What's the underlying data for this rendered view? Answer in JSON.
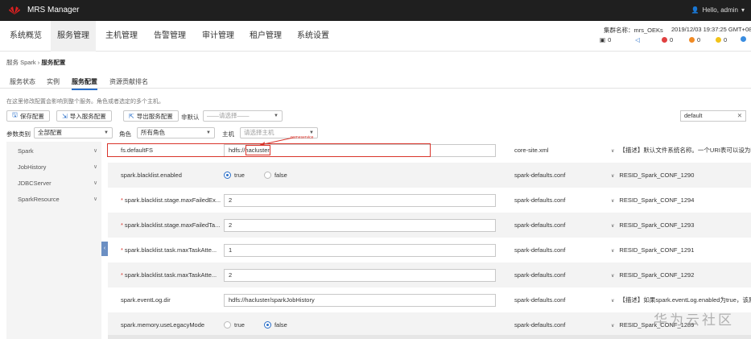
{
  "topbar": {
    "title": "MRS Manager",
    "user": "Hello, admin"
  },
  "nav": {
    "items": [
      "系统概览",
      "服务管理",
      "主机管理",
      "告警管理",
      "审计管理",
      "租户管理",
      "系统设置"
    ],
    "cluster_name": "集群名称：mrs_OEKs",
    "time": "2019/12/03 19:37:25 GMT+08",
    "counts": [
      "0",
      "0",
      "0",
      "0",
      "0"
    ]
  },
  "breadcrumb": {
    "root": "服务 Spark",
    "current": "服务配置"
  },
  "tabs": [
    "服务状态",
    "实例",
    "服务配置",
    "资源贡献排名"
  ],
  "hint": "在这里修改配置会影响到整个服务。角色或者选定的多个主机。",
  "toolbar": {
    "save": "保存配置",
    "import": "导入服务配置",
    "export": "导出服务配置",
    "non_default_label": "非默认",
    "non_default_placeholder": "——请选择——",
    "param_type_label": "参数类别",
    "param_type_value": "全部配置",
    "role_label": "角色",
    "role_value": "所有角色",
    "host_label": "主机",
    "host_placeholder": "请选择主机",
    "search_value": "default"
  },
  "sidebar": {
    "items": [
      "Spark",
      "JobHistory",
      "JDBCServer",
      "SparkResource"
    ]
  },
  "rows": [
    {
      "name": "fs.defaultFS",
      "required": false,
      "value": "hdfs://hacluster",
      "file": "core-site.xml",
      "desc": "【描述】默认文件系统名称。一个URI表可以设为hdf"
    },
    {
      "name": "spark.blacklist.enabled",
      "required": false,
      "radio": "true",
      "file": "spark-defaults.conf",
      "desc": "RESID_Spark_CONF_1290"
    },
    {
      "name": "spark.blacklist.stage.maxFailedEx...",
      "required": true,
      "value": "2",
      "file": "spark-defaults.conf",
      "desc": "RESID_Spark_CONF_1294"
    },
    {
      "name": "spark.blacklist.stage.maxFailedTa...",
      "required": true,
      "value": "2",
      "file": "spark-defaults.conf",
      "desc": "RESID_Spark_CONF_1293"
    },
    {
      "name": "spark.blacklist.task.maxTaskAtte...",
      "required": true,
      "value": "1",
      "file": "spark-defaults.conf",
      "desc": "RESID_Spark_CONF_1291"
    },
    {
      "name": "spark.blacklist.task.maxTaskAtte...",
      "required": true,
      "value": "2",
      "file": "spark-defaults.conf",
      "desc": "RESID_Spark_CONF_1292"
    },
    {
      "name": "spark.eventLog.dir",
      "required": false,
      "value": "hdfs://hacluster/sparkJobHistory",
      "file": "spark-defaults.conf",
      "desc": "【描述】如果spark.eventLog.enabled为true，该属"
    },
    {
      "name": "spark.memory.useLegacyMode",
      "required": false,
      "radio": "false",
      "file": "spark-defaults.conf",
      "desc": "RESID_Spark_CONF_1289"
    }
  ],
  "radio_labels": {
    "true": "true",
    "false": "false"
  },
  "annotation": "nameservice",
  "watermark": "华为云社区"
}
